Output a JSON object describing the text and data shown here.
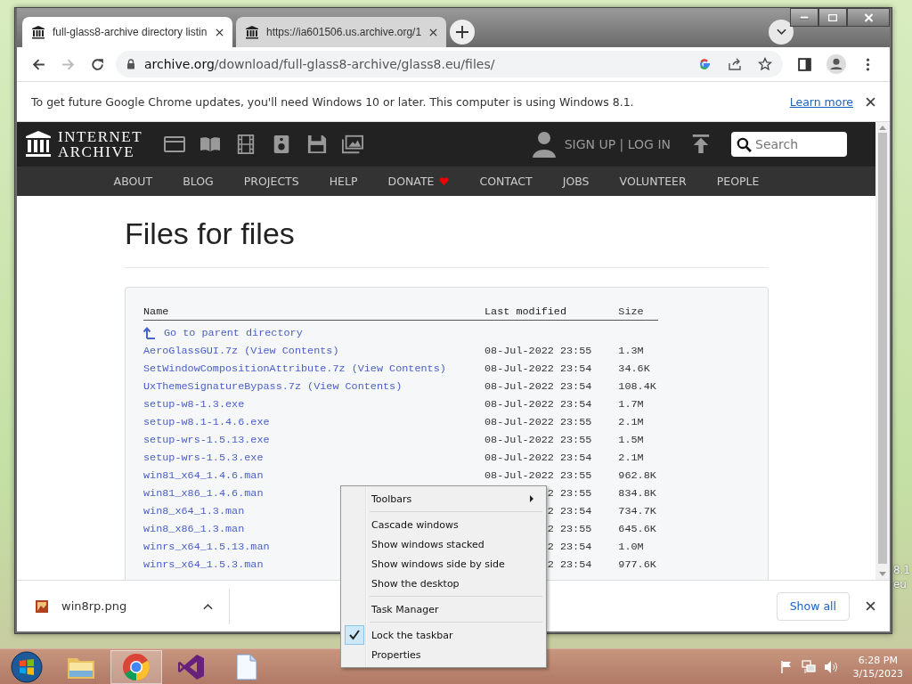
{
  "browser": {
    "tabs": [
      {
        "title": "full-glass8-archive directory listin",
        "selected": true
      },
      {
        "title": "https://ia601506.us.archive.org/1",
        "selected": false
      }
    ],
    "url_host": "archive.org",
    "url_path": "/download/full-glass8-archive/glass8.eu/files/"
  },
  "infobar": {
    "message": "To get future Google Chrome updates, you'll need Windows 10 or later. This computer is using Windows 8.1.",
    "link": "Learn more"
  },
  "site": {
    "logo": [
      "INTERNET",
      "ARCHIVE"
    ],
    "account": "SIGN UP | LOG IN",
    "search": {
      "placeholder": "Search"
    },
    "nav": [
      {
        "label": "ABOUT",
        "heart": false
      },
      {
        "label": "BLOG",
        "heart": false
      },
      {
        "label": "PROJECTS",
        "heart": false
      },
      {
        "label": "HELP",
        "heart": false
      },
      {
        "label": "DONATE",
        "heart": true
      },
      {
        "label": "CONTACT",
        "heart": false
      },
      {
        "label": "JOBS",
        "heart": false
      },
      {
        "label": "VOLUNTEER",
        "heart": false
      },
      {
        "label": "PEOPLE",
        "heart": false
      }
    ]
  },
  "page": {
    "title": "Files for files"
  },
  "table": {
    "columns": [
      "Name",
      "Last modified",
      "Size"
    ],
    "parent": "Go to parent directory",
    "rows": [
      {
        "name": "AeroGlassGUI.7z",
        "extra": "(View Contents)",
        "date": "08-Jul-2022 23:55",
        "size": "1.3M"
      },
      {
        "name": "SetWindowCompositionAttribute.7z",
        "extra": "(View Contents)",
        "date": "08-Jul-2022 23:54",
        "size": "34.6K"
      },
      {
        "name": "UxThemeSignatureBypass.7z",
        "extra": "(View Contents)",
        "date": "08-Jul-2022 23:54",
        "size": "108.4K"
      },
      {
        "name": "setup-w8-1.3.exe",
        "date": "08-Jul-2022 23:54",
        "size": "1.7M"
      },
      {
        "name": "setup-w8.1-1.4.6.exe",
        "date": "08-Jul-2022 23:55",
        "size": "2.1M"
      },
      {
        "name": "setup-wrs-1.5.13.exe",
        "date": "08-Jul-2022 23:55",
        "size": "1.5M"
      },
      {
        "name": "setup-wrs-1.5.3.exe",
        "date": "08-Jul-2022 23:54",
        "size": "2.1M"
      },
      {
        "name": "win81_x64_1.4.6.man",
        "date": "08-Jul-2022 23:55",
        "size": "962.8K"
      },
      {
        "name": "win81_x86_1.4.6.man",
        "date": "2 23:55",
        "size": "834.8K"
      },
      {
        "name": "win8_x64_1.3.man",
        "date": "2 23:54",
        "size": "734.7K"
      },
      {
        "name": "win8_x86_1.3.man",
        "date": "2 23:55",
        "size": "645.6K"
      },
      {
        "name": "winrs_x64_1.5.13.man",
        "date": "2 23:54",
        "size": "1.0M"
      },
      {
        "name": "winrs_x64_1.5.3.man",
        "date": "2 23:54",
        "size": "977.6K"
      }
    ]
  },
  "downloads": {
    "file": "win8rp.png",
    "button": "Show all"
  },
  "context_menu": {
    "items": [
      {
        "kind": "submenu",
        "label": "Toolbars"
      },
      {
        "kind": "separator"
      },
      {
        "kind": "item",
        "label": "Cascade windows"
      },
      {
        "kind": "item",
        "label": "Show windows stacked"
      },
      {
        "kind": "item",
        "label": "Show windows side by side"
      },
      {
        "kind": "item",
        "label": "Show the desktop"
      },
      {
        "kind": "separator"
      },
      {
        "kind": "item",
        "label": "Task Manager"
      },
      {
        "kind": "separator"
      },
      {
        "kind": "check",
        "label": "Lock the taskbar",
        "checked": true
      },
      {
        "kind": "item",
        "label": "Properties"
      }
    ]
  },
  "taskbar": {
    "apps": [
      {
        "kind": "folder",
        "selected": false
      },
      {
        "kind": "chrome",
        "selected": true
      },
      {
        "kind": "studio",
        "selected": false
      },
      {
        "kind": "document",
        "selected": false
      }
    ],
    "time": "6:28 PM",
    "date": "3/15/2023"
  },
  "desktop": {
    "edge_texts": [
      "8.1",
      "eu"
    ]
  }
}
